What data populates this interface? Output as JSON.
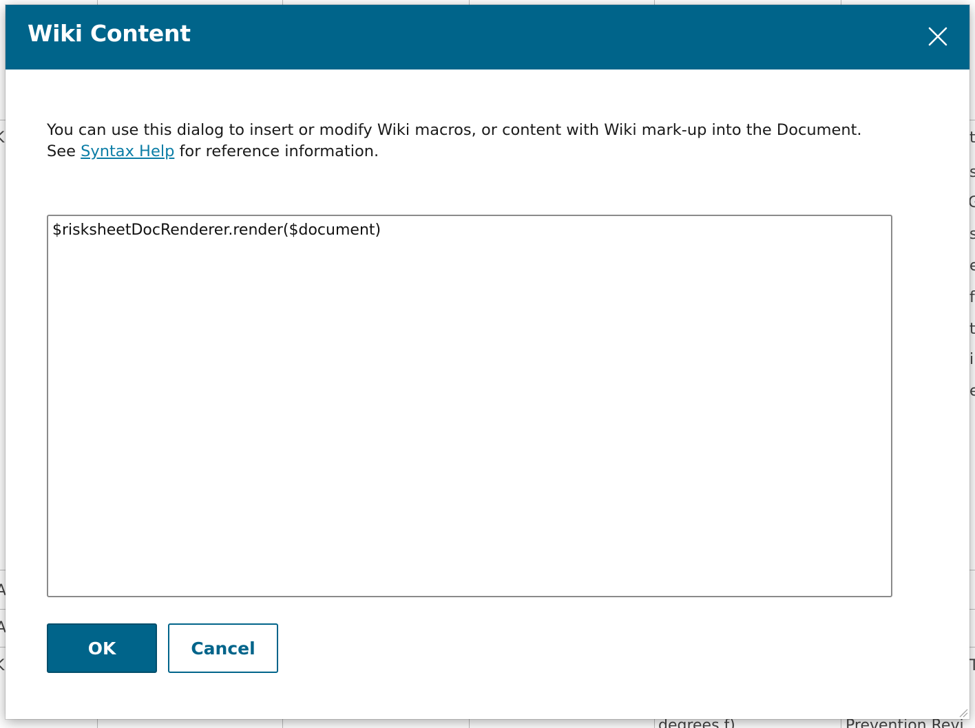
{
  "dialog": {
    "title": "Wiki Content",
    "close_icon": "close-icon",
    "intro": {
      "line1": "You can use this dialog to insert or modify Wiki macros, or content with Wiki mark-up into the Document.",
      "see_prefix": "See ",
      "link_label": "Syntax Help",
      "see_suffix": " for reference information."
    },
    "editor": {
      "value": "$risksheetDocRenderer.render($document)"
    },
    "buttons": {
      "ok_label": "OK",
      "cancel_label": "Cancel"
    }
  },
  "background": {
    "fragments": [
      "K",
      "A",
      "A",
      "K",
      "t",
      "s",
      "G",
      "s",
      "e",
      "f",
      "t",
      "i",
      "e",
      "T",
      "degrees f)",
      "Prevention Revi"
    ]
  },
  "colors": {
    "header": "#00648a",
    "link": "#0b7da6",
    "button_primary": "#00648a"
  }
}
